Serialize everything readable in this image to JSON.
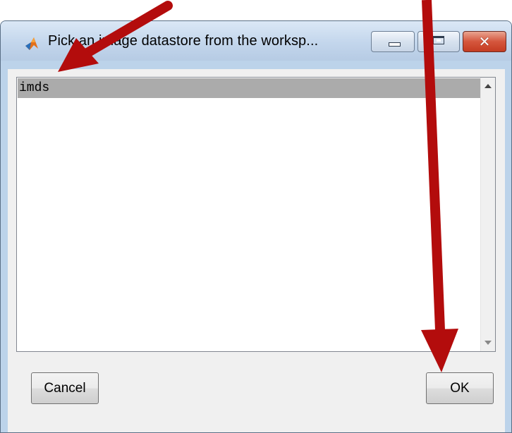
{
  "window": {
    "title": "Pick an image datastore from the worksp...",
    "icon": "matlab-logo-icon",
    "controls": [
      "minimize-icon",
      "restore-icon",
      "close-icon"
    ],
    "close_glyph": "✕"
  },
  "listbox": {
    "items": [
      {
        "label": "imds",
        "selected": true
      }
    ],
    "scrollbar": {
      "up": "scroll-up-arrow-icon",
      "down": "scroll-down-arrow-icon"
    }
  },
  "buttons": {
    "cancel_label": "Cancel",
    "ok_label": "OK"
  },
  "annotations": {
    "arrow_color": "#b30c0c",
    "arrows": [
      "arrow-pointing-to-imds-item",
      "arrow-pointing-to-ok-button"
    ]
  },
  "colors": {
    "selection": "#ababab",
    "close_button": "#c43c22",
    "title_bar": "#c3d6ec"
  }
}
